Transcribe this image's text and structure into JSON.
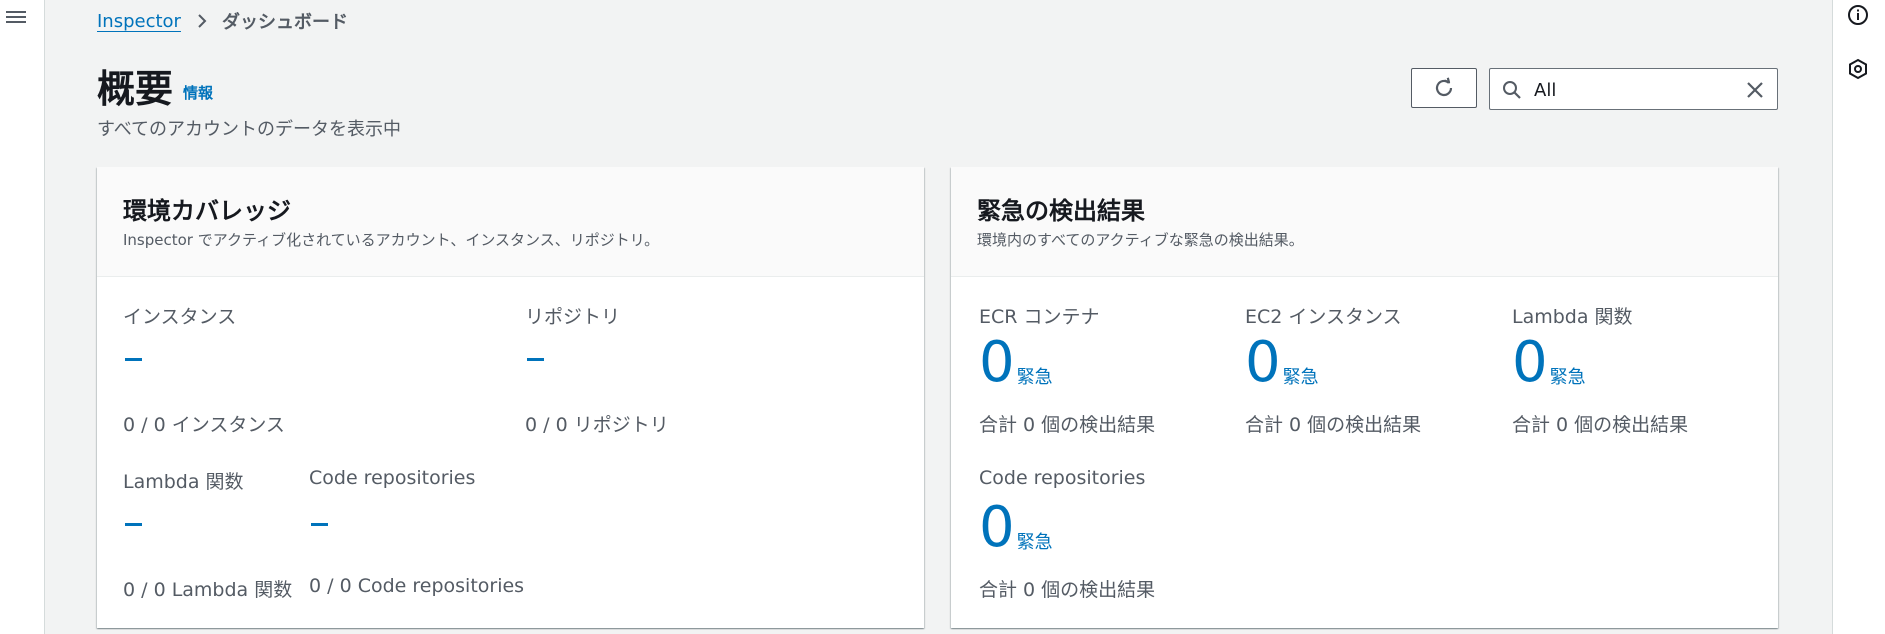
{
  "breadcrumb": {
    "root": "Inspector",
    "current": "ダッシュボード"
  },
  "page": {
    "title": "概要",
    "info": "情報",
    "description": "すべてのアカウントのデータを表示中"
  },
  "filter": {
    "search_value": "All"
  },
  "coverage": {
    "title": "環境カバレッジ",
    "subtitle": "Inspector でアクティブ化されているアカウント、インスタンス、リポジトリ。",
    "metrics": [
      {
        "label": "インスタンス",
        "value": "–",
        "detail": "0 / 0 インスタンス"
      },
      {
        "label": "リポジトリ",
        "value": "–",
        "detail": "0 / 0 リポジトリ"
      },
      {
        "label": "Lambda 関数",
        "value": "–",
        "detail": "0 / 0 Lambda 関数"
      },
      {
        "label": "Code repositories",
        "value": "–",
        "detail": "0 / 0 Code repositories"
      }
    ]
  },
  "critical": {
    "title": "緊急の検出結果",
    "subtitle": "環境内のすべてのアクティブな緊急の検出結果。",
    "metrics": [
      {
        "label": "ECR コンテナ",
        "value": "0",
        "unit": "緊急",
        "detail": "合計 0 個の検出結果"
      },
      {
        "label": "EC2 インスタンス",
        "value": "0",
        "unit": "緊急",
        "detail": "合計 0 個の検出結果"
      },
      {
        "label": "Lambda 関数",
        "value": "0",
        "unit": "緊急",
        "detail": "合計 0 個の検出結果"
      },
      {
        "label": "Code repositories",
        "value": "0",
        "unit": "緊急",
        "detail": "合計 0 個の検出結果"
      }
    ]
  },
  "colors": {
    "link": "#0073bb",
    "text": "#16191f",
    "muted": "#545b64",
    "background": "#f2f3f3"
  },
  "icons": {
    "menu": "hamburger-menu-icon",
    "info": "info-circle-icon",
    "hex": "hexagon-settings-icon",
    "refresh": "refresh-icon",
    "search": "search-icon",
    "clear": "close-icon",
    "separator": "chevron-right-icon"
  }
}
